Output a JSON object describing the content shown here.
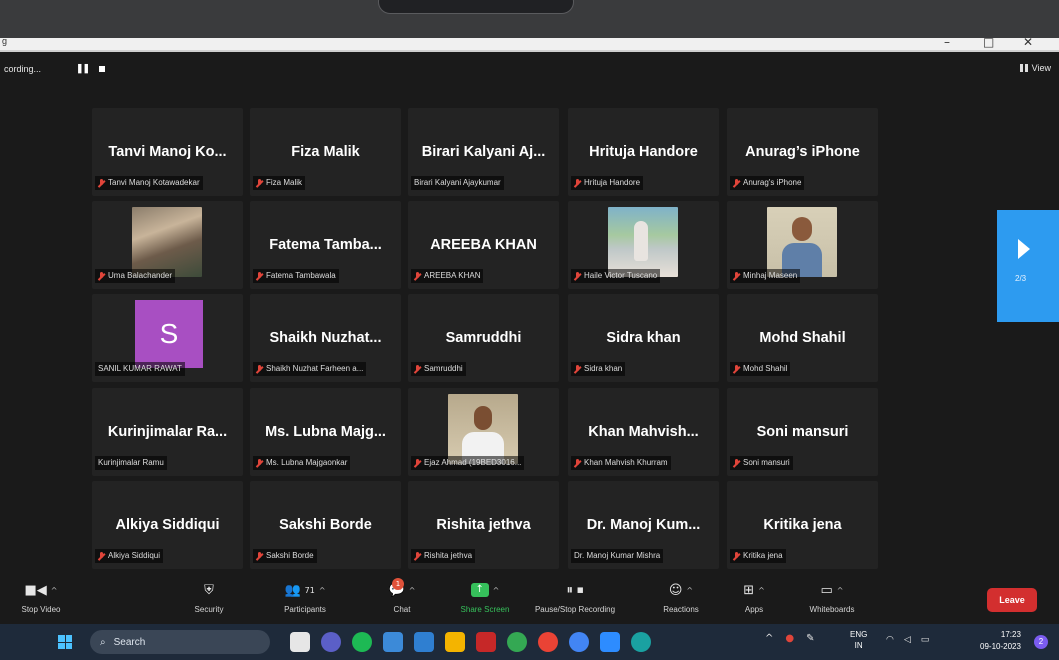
{
  "window": {
    "title": "g"
  },
  "meeting_bar": {
    "recording_label": "cording...",
    "view_label": "View"
  },
  "tiles": [
    {
      "big": "Tanvi Manoj Ko...",
      "caption": "Tanvi Manoj Kotawadekar",
      "muted": true
    },
    {
      "big": "Fiza Malik",
      "caption": "Fiza Malik",
      "muted": true
    },
    {
      "big": "Birari Kalyani Aj...",
      "caption": "Birari Kalyani Ajaykumar",
      "muted": false
    },
    {
      "big": "Hrituja Handore",
      "caption": "Hrituja Handore",
      "muted": true
    },
    {
      "big": "Anurag’s iPhone",
      "caption": "Anurag's iPhone",
      "muted": true
    },
    {
      "big": "",
      "caption": "Uma Balachander",
      "muted": true,
      "photo": "group"
    },
    {
      "big": "Fatema Tamba...",
      "caption": "Fatema Tambawala",
      "muted": true
    },
    {
      "big": "AREEBA KHAN",
      "caption": "AREEBA KHAN",
      "muted": true
    },
    {
      "big": "",
      "caption": "Haile Victor Tuscano",
      "muted": true,
      "photo": "outdoor"
    },
    {
      "big": "",
      "caption": "Minhaj Maseen",
      "muted": true,
      "photo": "portrait"
    },
    {
      "big": "",
      "caption": "SANIL KUMAR RAWAT",
      "muted": false,
      "avatar": "S"
    },
    {
      "big": "Shaikh Nuzhat...",
      "caption": "Shaikh Nuzhat Farheen a...",
      "muted": true
    },
    {
      "big": "Samruddhi",
      "caption": "Samruddhi",
      "muted": true
    },
    {
      "big": "Sidra khan",
      "caption": "Sidra khan",
      "muted": true
    },
    {
      "big": "Mohd Shahil",
      "caption": "Mohd Shahil",
      "muted": true
    },
    {
      "big": "Kurinjimalar Ra...",
      "caption": "Kurinjimalar Ramu",
      "muted": false
    },
    {
      "big": "Ms. Lubna Majg...",
      "caption": "Ms. Lubna Majgaonkar",
      "muted": true
    },
    {
      "big": "",
      "caption": "Ejaz Ahmad (19BED3016...",
      "muted": true,
      "photo": "portrait2"
    },
    {
      "big": "Khan Mahvish...",
      "caption": "Khan Mahvish Khurram",
      "muted": true
    },
    {
      "big": "Soni mansuri",
      "caption": "Soni mansuri",
      "muted": true
    },
    {
      "big": "Alkiya Siddiqui",
      "caption": "Alkiya Siddiqui",
      "muted": true
    },
    {
      "big": "Sakshi Borde",
      "caption": "Sakshi Borde",
      "muted": true
    },
    {
      "big": "Rishita jethva",
      "caption": "Rishita jethva",
      "muted": true
    },
    {
      "big": "Dr. Manoj Kum...",
      "caption": "Dr. Manoj Kumar Mishra",
      "muted": false
    },
    {
      "big": "Kritika jena",
      "caption": "Kritika jena",
      "muted": true
    }
  ],
  "pager": {
    "label": "2/3"
  },
  "toolbar": {
    "stop_video": "Stop Video",
    "security": "Security",
    "participants": "Participants",
    "participants_count": "71",
    "chat": "Chat",
    "chat_badge": "1",
    "share_screen": "Share Screen",
    "pause_stop_recording": "Pause/Stop Recording",
    "reactions": "Reactions",
    "apps": "Apps",
    "whiteboards": "Whiteboards",
    "leave": "Leave"
  },
  "taskbar": {
    "search_placeholder": "Search",
    "lang_top": "ENG",
    "lang_bottom": "IN",
    "time": "17:23",
    "date": "09-10-2023",
    "notification_count": "2"
  },
  "colors": {
    "accent_blue": "#2d9bf0",
    "share_green": "#36c05b",
    "leave_red": "#d32f2f",
    "muted_red": "#e0453a",
    "avatar_purple": "#a84fc2"
  }
}
